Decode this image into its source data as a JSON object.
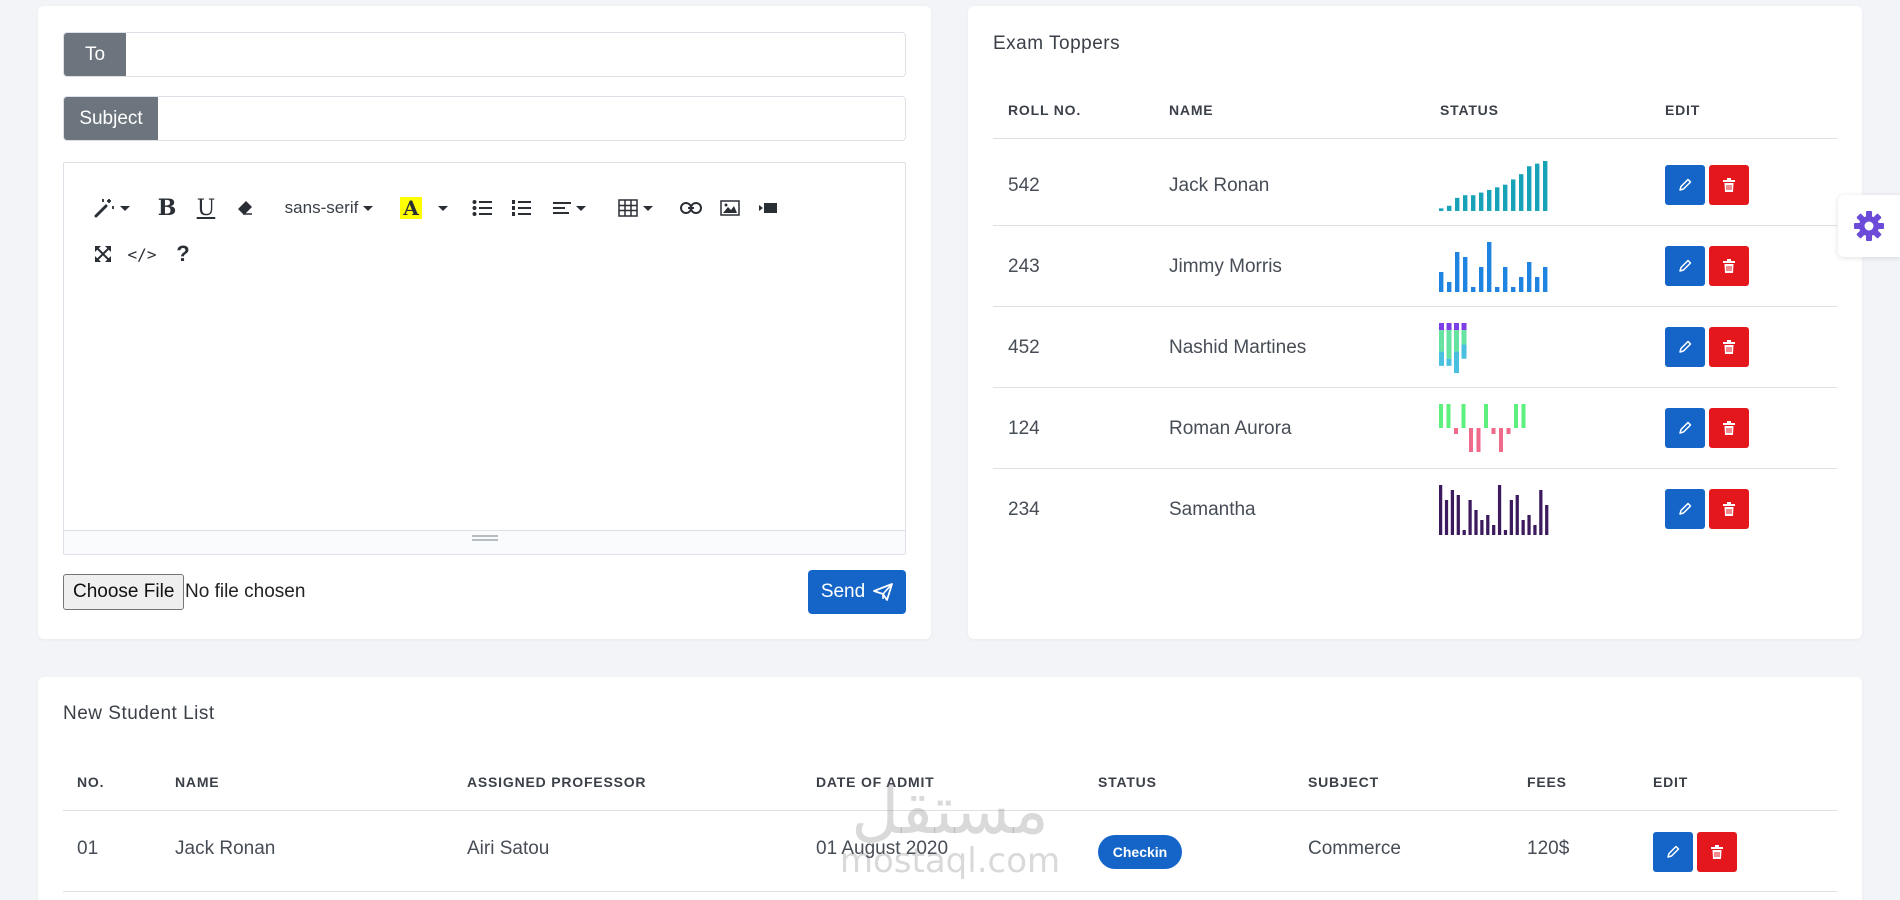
{
  "compose": {
    "to_label": "To",
    "to_value": "",
    "subject_label": "Subject",
    "subject_value": "",
    "toolbar": {
      "font_name": "sans-serif",
      "bold": "B",
      "underline": "U",
      "code_view": "</>",
      "help": "?",
      "highlight_color": "#ffff00"
    },
    "body_value": "",
    "file_button": "Choose File",
    "file_status": "No file chosen",
    "send_label": "Send"
  },
  "toppers": {
    "title": "Exam Toppers",
    "columns": [
      "ROLL NO.",
      "NAME",
      "STATUS",
      "EDIT"
    ],
    "rows": [
      {
        "roll": "542",
        "name": "Jack Ronan",
        "chart": {
          "type": "bar",
          "color": "#17a2b8",
          "values": [
            1,
            2,
            5,
            6,
            6,
            7,
            8,
            9,
            10,
            12,
            14,
            17,
            18,
            19
          ]
        }
      },
      {
        "roll": "243",
        "name": "Jimmy Morris",
        "chart": {
          "type": "bar",
          "color": "#1f83e0",
          "values": [
            4,
            2,
            8,
            7,
            1,
            5,
            10,
            1,
            5,
            1,
            3,
            6,
            3,
            5
          ]
        }
      },
      {
        "roll": "452",
        "name": "Nashid Martines",
        "chart": {
          "type": "stacked",
          "colors": [
            "#7c3fe6",
            "#66e3a0",
            "#4ac0e0"
          ],
          "values": [
            [
              1,
              3,
              2
            ],
            [
              1,
              4,
              1
            ],
            [
              1,
              3,
              3
            ],
            [
              1,
              2,
              2
            ]
          ]
        }
      },
      {
        "roll": "124",
        "name": "Roman Aurora",
        "chart": {
          "type": "posneg",
          "pos_color": "#5ef07e",
          "neg_color": "#f06a8a",
          "values": [
            4,
            4,
            -1,
            4,
            -4,
            -4,
            4,
            -1,
            -4,
            -1,
            4,
            4
          ]
        }
      },
      {
        "roll": "234",
        "name": "Samantha",
        "chart": {
          "type": "bar",
          "color": "#3c1a5e",
          "values": [
            10,
            7,
            9,
            8,
            1,
            7,
            5,
            3,
            4,
            2,
            10,
            1,
            7,
            8,
            3,
            4,
            2,
            9,
            6
          ]
        }
      }
    ]
  },
  "students": {
    "title": "New Student List",
    "columns": [
      "NO.",
      "NAME",
      "ASSIGNED PROFESSOR",
      "DATE OF ADMIT",
      "STATUS",
      "SUBJECT",
      "FEES",
      "EDIT"
    ],
    "rows": [
      {
        "no": "01",
        "name": "Jack Ronan",
        "professor": "Airi Satou",
        "date": "01 August 2020",
        "status": "Checkin",
        "subject": "Commerce",
        "fees": "120$"
      }
    ]
  },
  "watermark": {
    "arabic": "مستقل",
    "latin": "mostaql.com"
  },
  "icons": [
    "magic-wand-icon",
    "eraser-icon",
    "bulleted-list-icon",
    "numbered-list-icon",
    "align-left-icon",
    "table-icon",
    "link-icon",
    "image-icon",
    "video-icon",
    "fullscreen-icon",
    "paper-plane-icon",
    "pencil-icon",
    "trash-icon",
    "gear-icon"
  ]
}
